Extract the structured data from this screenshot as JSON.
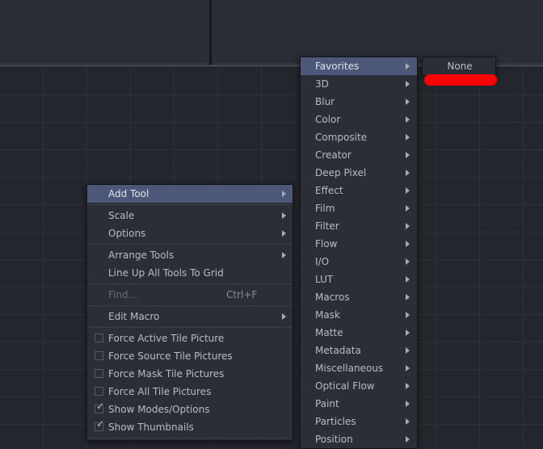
{
  "app": {
    "background_color": "#24262d",
    "grid_line_color": "#2e313a",
    "menu_background_color": "#2b2e36",
    "menu_text_color": "#b9bcc4",
    "highlight_color": "#4d5878",
    "disabled_text_color": "#6a6d75",
    "marker_color": "#fc0004"
  },
  "viewers": {
    "left_pane_name": "viewer-pane-left",
    "right_pane_name": "viewer-pane-right"
  },
  "context_menu": {
    "name": "flow-context-menu",
    "items": [
      {
        "label": "Add Tool",
        "type": "submenu",
        "highlighted": true,
        "arrow": true
      },
      {
        "type": "separator"
      },
      {
        "label": "Scale",
        "type": "submenu",
        "arrow": true
      },
      {
        "label": "Options",
        "type": "submenu",
        "arrow": true
      },
      {
        "type": "separator"
      },
      {
        "label": "Arrange Tools",
        "type": "submenu",
        "arrow": true
      },
      {
        "label": "Line Up All Tools To Grid",
        "type": "action"
      },
      {
        "type": "separator"
      },
      {
        "label": "Find...",
        "shortcut": "Ctrl+F",
        "type": "action",
        "disabled": true
      },
      {
        "type": "separator"
      },
      {
        "label": "Edit Macro",
        "type": "submenu",
        "arrow": true
      },
      {
        "type": "separator"
      },
      {
        "label": "Force Active Tile Picture",
        "type": "checkbox",
        "checked": false
      },
      {
        "label": "Force Source Tile Pictures",
        "type": "checkbox",
        "checked": false
      },
      {
        "label": "Force Mask Tile Pictures",
        "type": "checkbox",
        "checked": false
      },
      {
        "label": "Force All Tile Pictures",
        "type": "checkbox",
        "checked": false
      },
      {
        "label": "Show Modes/Options",
        "type": "checkbox",
        "checked": true
      },
      {
        "label": "Show Thumbnails",
        "type": "checkbox",
        "checked": true
      },
      {
        "type": "separator"
      }
    ],
    "check_glyph": "✓"
  },
  "add_tool_submenu": {
    "name": "add-tool-submenu",
    "items": [
      {
        "label": "Favorites",
        "highlighted": true,
        "arrow": true
      },
      {
        "label": "3D",
        "arrow": true
      },
      {
        "label": "Blur",
        "arrow": true
      },
      {
        "label": "Color",
        "arrow": true
      },
      {
        "label": "Composite",
        "arrow": true
      },
      {
        "label": "Creator",
        "arrow": true
      },
      {
        "label": "Deep Pixel",
        "arrow": true
      },
      {
        "label": "Effect",
        "arrow": true
      },
      {
        "label": "Film",
        "arrow": true
      },
      {
        "label": "Filter",
        "arrow": true
      },
      {
        "label": "Flow",
        "arrow": true
      },
      {
        "label": "I/O",
        "arrow": true
      },
      {
        "label": "LUT",
        "arrow": true
      },
      {
        "label": "Macros",
        "arrow": true
      },
      {
        "label": "Mask",
        "arrow": true
      },
      {
        "label": "Matte",
        "arrow": true
      },
      {
        "label": "Metadata",
        "arrow": true
      },
      {
        "label": "Miscellaneous",
        "arrow": true
      },
      {
        "label": "Optical Flow",
        "arrow": true
      },
      {
        "label": "Paint",
        "arrow": true
      },
      {
        "label": "Particles",
        "arrow": true
      },
      {
        "label": "Position",
        "arrow": true
      }
    ]
  },
  "favorites_submenu": {
    "name": "favorites-submenu",
    "items": [
      {
        "label": "None"
      }
    ]
  },
  "marker": {
    "name": "red-highlight-bar",
    "color": "#fc0004"
  }
}
